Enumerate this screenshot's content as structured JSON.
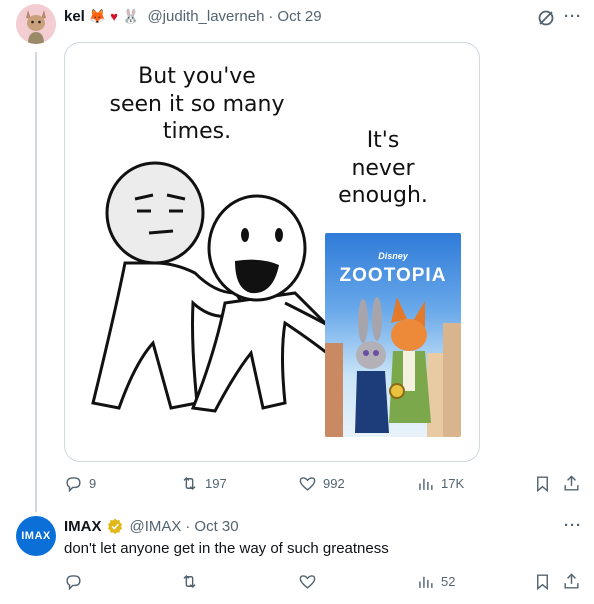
{
  "tweet1": {
    "display_name": "kel",
    "emojis": [
      "fox-emoji",
      "heart-emoji",
      "rabbit-emoji"
    ],
    "handle": "@judith_laverneh",
    "date_sep": "·",
    "date": "Oct 29",
    "comic": {
      "left_text_line1": "But you've",
      "left_text_line2": "seen it so many",
      "left_text_line3": "times.",
      "right_text_line1": "It's",
      "right_text_line2": "never",
      "right_text_line3": "enough.",
      "poster_brand": "Disney",
      "poster_title": "ZOOTOPIA"
    },
    "actions": {
      "replies": "9",
      "reposts": "197",
      "likes": "992",
      "views": "17K"
    }
  },
  "tweet2": {
    "display_name": "IMAX",
    "avatar_text": "IMAX",
    "handle": "@IMAX",
    "date_sep": "·",
    "date": "Oct 30",
    "text": "don't let anyone get in the way of such greatness",
    "actions": {
      "replies": "",
      "reposts": "",
      "likes": "",
      "views": "52"
    }
  },
  "colors": {
    "text_primary": "#0f1419",
    "text_secondary": "#536471",
    "border": "#cfd9de",
    "imax_blue": "#0a6fd6",
    "verified_gold": "#e2b719"
  }
}
